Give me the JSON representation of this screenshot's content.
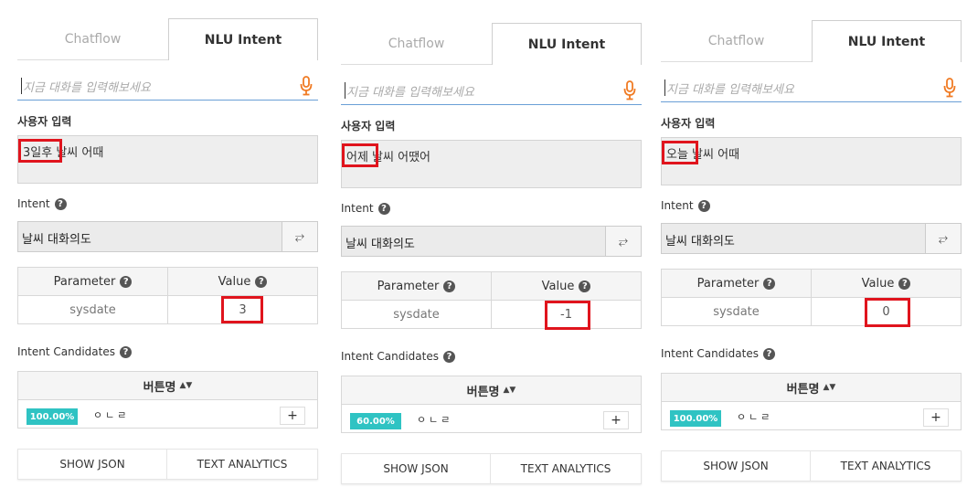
{
  "colors": {
    "highlight": "#e0141d",
    "badge": "#2fc3c3",
    "mic": "#f07b24",
    "input_underline": "#6a9fd6"
  },
  "tabs": {
    "chatflow": "Chatflow",
    "nlu": "NLU Intent"
  },
  "input_placeholder": "지금 대화를 입력해보세요",
  "labels": {
    "user_input": "사용자 입력",
    "intent": "Intent",
    "param_header": "Parameter",
    "value_header": "Value",
    "candidates": "Intent Candidates",
    "button_name": "버튼명"
  },
  "intent_value": "날씨 대화의도",
  "param_key": "sysdate",
  "candidate_name": "ㅇㄴㄹ",
  "actions": {
    "show_json": "SHOW JSON",
    "text_analytics": "TEXT ANALYTICS"
  },
  "icons": {
    "help": "help-circle-icon",
    "swap": "swap-arrows-icon",
    "mic": "microphone-icon",
    "sort": "sort-icon",
    "plus": "plus-icon"
  },
  "panels": [
    {
      "highlight_word": "3일후",
      "rest_text": " 날씨 어때",
      "param_value": "3",
      "confidence": "100.00%"
    },
    {
      "highlight_word": "어제",
      "rest_text": " 날씨 어땠어",
      "param_value": "-1",
      "confidence": "60.00%"
    },
    {
      "highlight_word": "오늘",
      "rest_text": " 날씨 어때",
      "param_value": "0",
      "confidence": "100.00%"
    }
  ]
}
